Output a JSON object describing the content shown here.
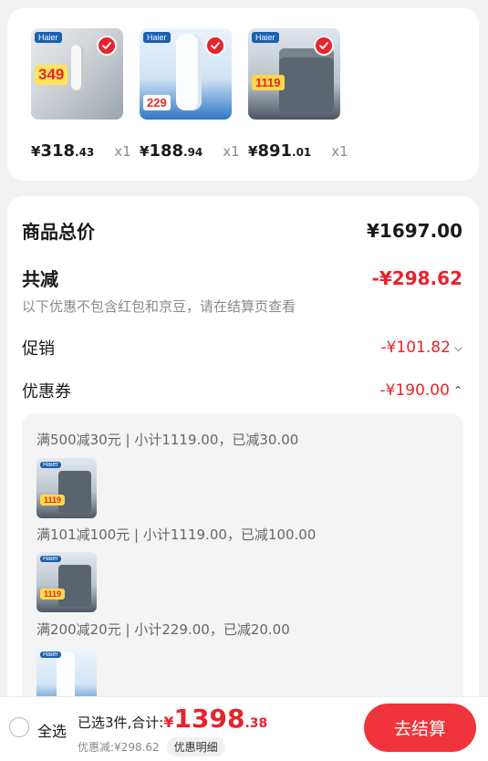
{
  "items": [
    {
      "brand": "Haier",
      "img_price": "349",
      "yen": "¥",
      "int": "318",
      "dec": ".43",
      "qty": "x1"
    },
    {
      "brand": "Haier",
      "img_price": "229",
      "yen": "¥",
      "int": "188",
      "dec": ".94",
      "qty": "x1"
    },
    {
      "brand": "Haier",
      "img_price": "1119",
      "yen": "¥",
      "int": "891",
      "dec": ".01",
      "qty": "x1"
    }
  ],
  "summary": {
    "goods_total_label": "商品总价",
    "goods_total_value": "¥1697.00",
    "total_reduce_label": "共减",
    "total_reduce_value": "-¥298.62",
    "note": "以下优惠不包含红包和京豆，请在结算页查看",
    "promo_label": "促销",
    "promo_value": "-¥101.82",
    "coupon_label": "优惠券",
    "coupon_value": "-¥190.00"
  },
  "coupons": [
    {
      "rule": "满500减30元",
      "detail": "小计1119.00，已减30.00"
    },
    {
      "rule": "满101减100元",
      "detail": "小计1119.00，已减100.00"
    },
    {
      "rule": "满200减20元",
      "detail": "小计229.00，已减20.00"
    }
  ],
  "coupon_thumbs": [
    {
      "brand": "Haier",
      "img_price": "1119"
    },
    {
      "brand": "Haier",
      "img_price": "1119"
    },
    {
      "brand": "Haier"
    }
  ],
  "footer": {
    "select_all": "全选",
    "selected_text": "已选3件,合计:",
    "total_yen": "¥",
    "total_int": "1398",
    "total_dec": ".38",
    "discount_text": "优惠减:¥298.62",
    "detail_button": "优惠明细",
    "checkout_button": "去结算"
  },
  "colors": {
    "accent": "#e8232c",
    "checkout": "#f0343b"
  }
}
